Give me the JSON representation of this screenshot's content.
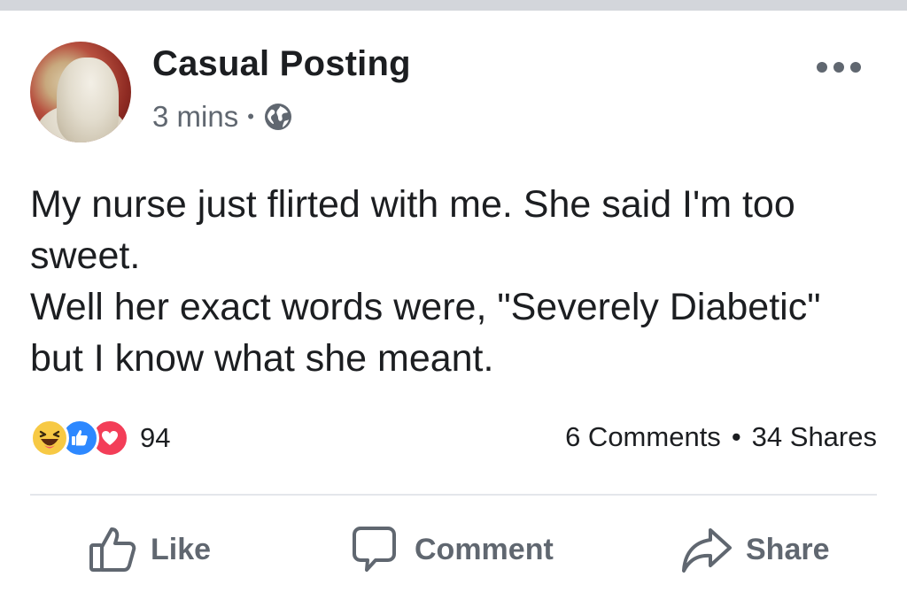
{
  "post": {
    "author": "Casual Posting",
    "time": "3 mins",
    "privacy_icon": "globe-icon",
    "more_icon": "more-options-icon",
    "body_lines": [
      "My nurse just flirted with me. She said I'm too sweet.",
      "Well her exact words were, \"Severely Diabetic\" but I know what she meant."
    ]
  },
  "stats": {
    "reactions": [
      "haha",
      "like",
      "love"
    ],
    "reaction_count": "94",
    "comments": "6 Comments",
    "separator": "•",
    "shares": "34 Shares"
  },
  "actions": {
    "like": "Like",
    "comment": "Comment",
    "share": "Share"
  },
  "colors": {
    "like_blue": "#2d88ff",
    "love_red": "#f33e58",
    "haha_yellow": "#f7c944",
    "secondary_text": "#606770",
    "primary_text": "#1c1e21"
  }
}
